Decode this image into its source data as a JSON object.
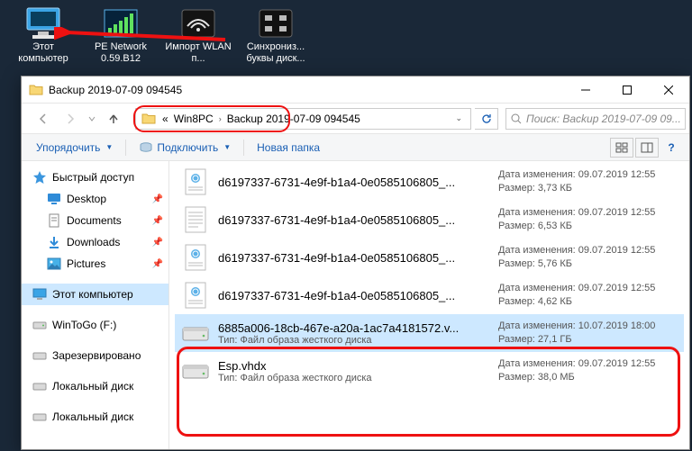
{
  "desktop": {
    "items": [
      {
        "label": "Этот компьютер",
        "icon": "pc"
      },
      {
        "label": "PE Network 0.59.B12",
        "icon": "net"
      },
      {
        "label": "Импорт WLAN п...",
        "icon": "wifi"
      },
      {
        "label": "Синхрониз... буквы диск...",
        "icon": "sync"
      }
    ]
  },
  "window": {
    "title": "Backup 2019-07-09 094545",
    "controls": {
      "min": "–",
      "max": "▢",
      "close": "✕"
    }
  },
  "address": {
    "prefix": "«",
    "seg1": "Win8PC",
    "seg2": "Backup 2019-07-09 094545",
    "refresh_visible": true
  },
  "search": {
    "placeholder": "Поиск: Backup 2019-07-09 09..."
  },
  "toolbar": {
    "organize": "Упорядочить",
    "connect": "Подключить",
    "newfolder": "Новая папка"
  },
  "nav": {
    "quick": "Быстрый доступ",
    "items": [
      {
        "label": "Desktop",
        "icon": "desktop",
        "pin": true
      },
      {
        "label": "Documents",
        "icon": "doc",
        "pin": true
      },
      {
        "label": "Downloads",
        "icon": "down",
        "pin": true
      },
      {
        "label": "Pictures",
        "icon": "pic",
        "pin": true
      }
    ],
    "thispc": "Этот компьютер",
    "drives": [
      {
        "label": "WinToGo (F:)",
        "icon": "drive"
      },
      {
        "label": "Зарезервировано",
        "icon": "drive"
      },
      {
        "label": "Локальный диск",
        "icon": "drive"
      },
      {
        "label": "Локальный диск",
        "icon": "drive"
      }
    ]
  },
  "labels": {
    "date": "Дата изменения:",
    "size": "Размер:",
    "type": "Тип:"
  },
  "files": [
    {
      "name": "d6197337-6731-4e9f-b1a4-0e0585106805_...",
      "icon": "xml",
      "date": "09.07.2019 12:55",
      "size": "3,73 КБ"
    },
    {
      "name": "d6197337-6731-4e9f-b1a4-0e0585106805_...",
      "icon": "txt",
      "date": "09.07.2019 12:55",
      "size": "6,53 КБ"
    },
    {
      "name": "d6197337-6731-4e9f-b1a4-0e0585106805_...",
      "icon": "xml",
      "date": "09.07.2019 12:55",
      "size": "5,76 КБ"
    },
    {
      "name": "d6197337-6731-4e9f-b1a4-0e0585106805_...",
      "icon": "xml",
      "date": "09.07.2019 12:55",
      "size": "4,62 КБ"
    },
    {
      "name": "6885a006-18cb-467e-a20a-1ac7a4181572.v...",
      "icon": "disk",
      "type": "Файл образа жесткого диска",
      "date": "10.07.2019 18:00",
      "size": "27,1 ГБ",
      "selected": true
    },
    {
      "name": "Esp.vhdx",
      "icon": "disk",
      "type": "Файл образа жесткого диска",
      "date": "09.07.2019 12:55",
      "size": "38,0 МБ"
    }
  ]
}
